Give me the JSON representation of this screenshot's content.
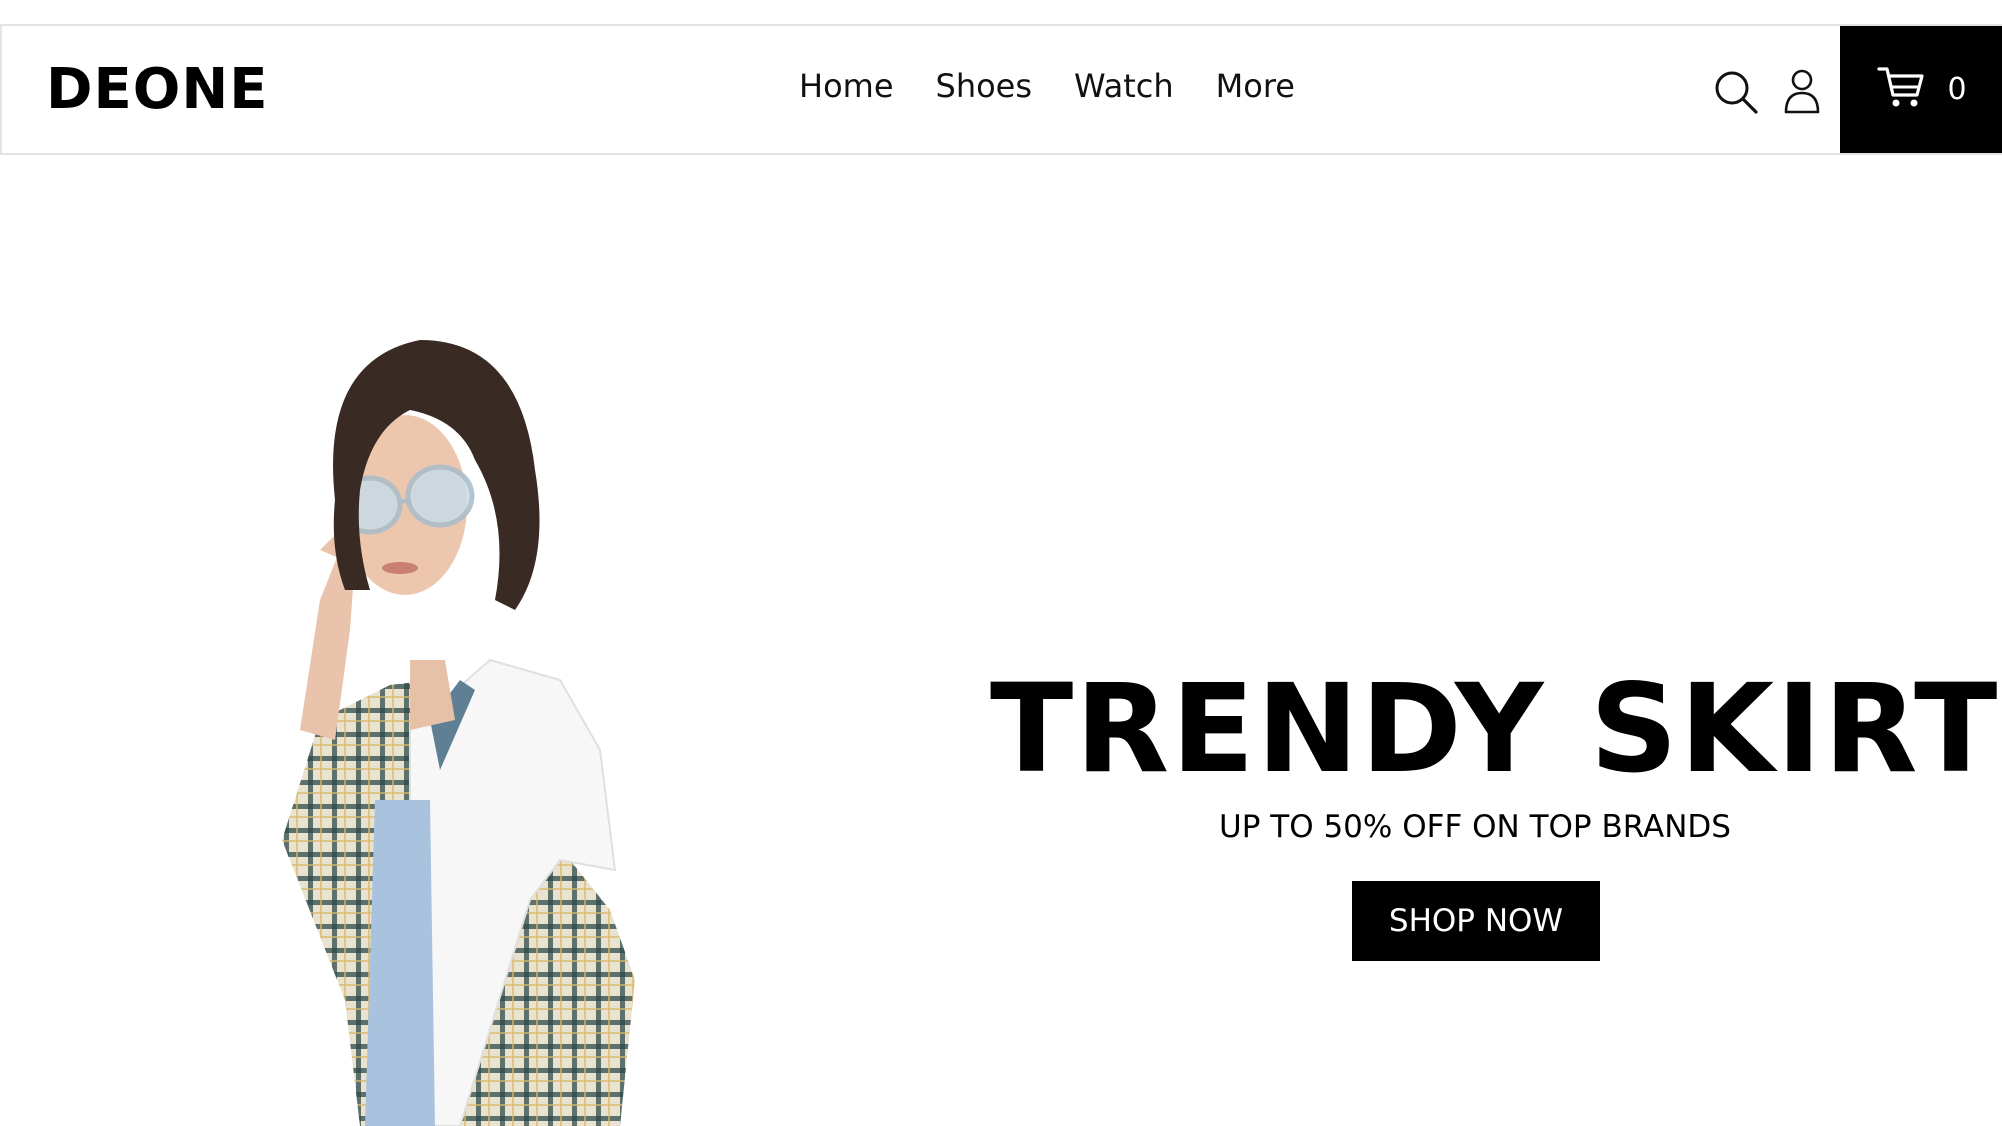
{
  "header": {
    "logo": "DEONE",
    "nav": [
      "Home",
      "Shoes",
      "Watch",
      "More"
    ],
    "icons": {
      "search": "search-icon",
      "account": "user-icon",
      "cart": "cart-icon"
    },
    "cart_count": "0"
  },
  "hero": {
    "title": "TRENDY SKIRTS",
    "subtitle": "UP TO 50% OFF ON TOP BRANDS",
    "cta_label": "SHOP NOW"
  },
  "colors": {
    "accent": "#000000",
    "background": "#ffffff",
    "header_border": "#e3e3e3"
  }
}
